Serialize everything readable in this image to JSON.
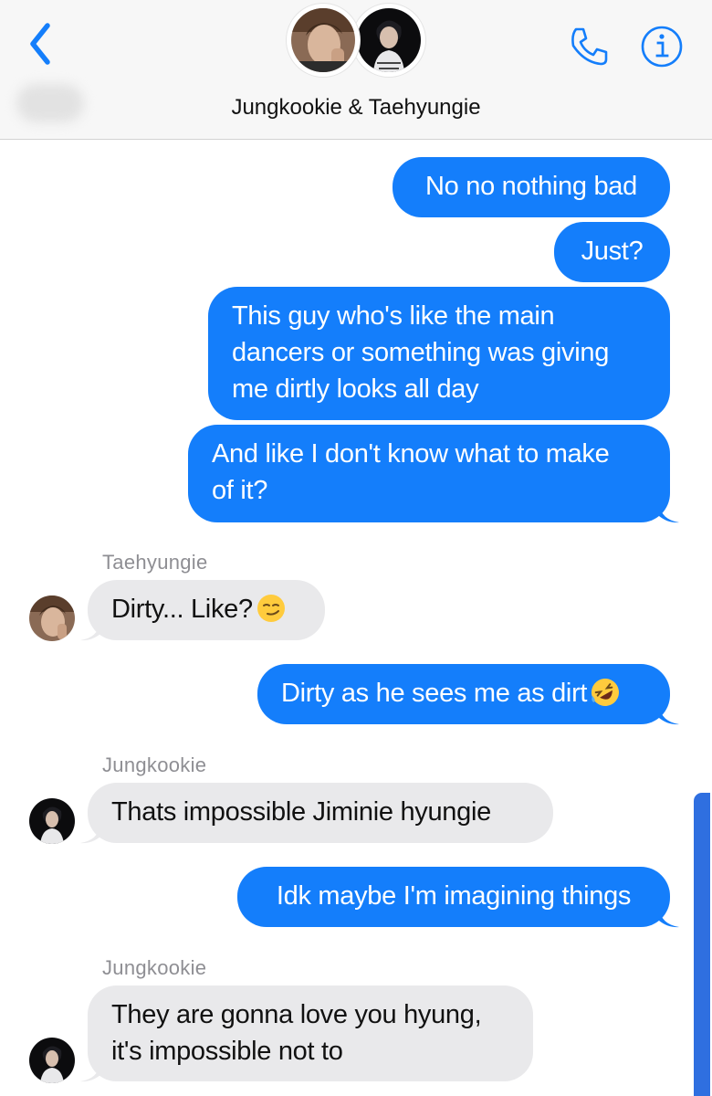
{
  "header": {
    "title": "Jungkookie & Taehyungie",
    "back_icon": "chevron-left-icon",
    "call_icon": "phone-icon",
    "info_icon": "info-icon"
  },
  "colors": {
    "outgoing_bubble": "#147efb",
    "incoming_bubble": "#e9e9eb",
    "accent": "#147efb"
  },
  "messages": [
    {
      "direction": "out",
      "text": "No no nothing bad"
    },
    {
      "direction": "out",
      "text": "Just?"
    },
    {
      "direction": "out",
      "line1": "This guy who's like the main",
      "line2": "dancers or something was giving",
      "line3": "me dirtly looks all day"
    },
    {
      "direction": "out",
      "line1": "And like I don't know what to make",
      "line2": "of it?"
    },
    {
      "direction": "in",
      "sender": "Taehyungie",
      "text": "Dirty... Like?",
      "emoji": "smirking-face-emoji"
    },
    {
      "direction": "out",
      "text": "Dirty as he sees me as dirt",
      "emoji": "rolling-on-floor-laughing-emoji"
    },
    {
      "direction": "in",
      "sender": "Jungkookie",
      "text": "Thats impossible Jiminie hyungie"
    },
    {
      "direction": "out",
      "text": "Idk maybe I'm imagining things"
    },
    {
      "direction": "in",
      "sender": "Jungkookie",
      "line1": "They are gonna love you hyung,",
      "line2": "it's impossible not to"
    }
  ]
}
